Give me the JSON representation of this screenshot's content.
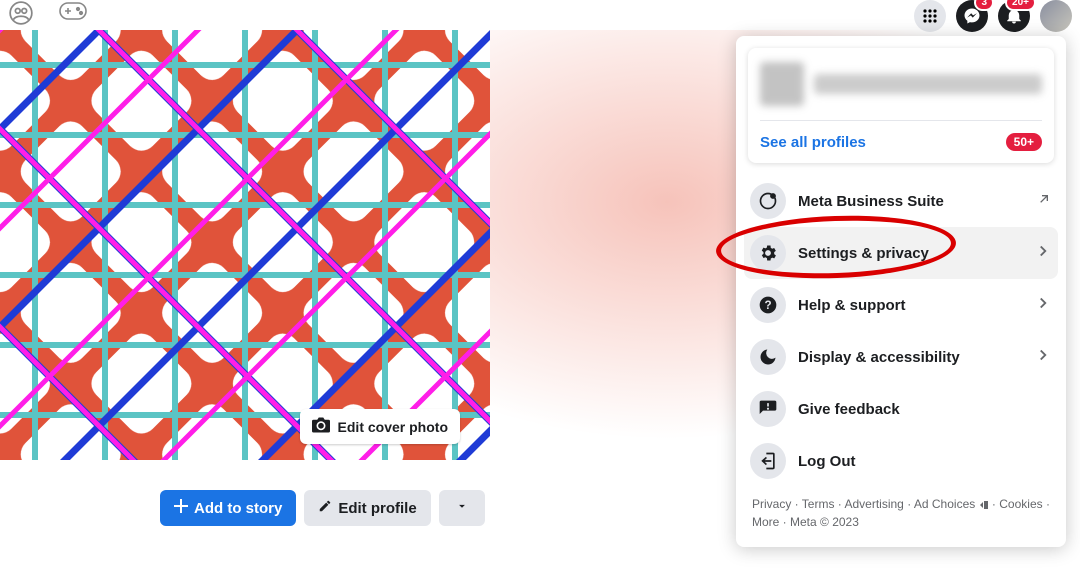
{
  "topbar": {
    "messenger_badge": "3",
    "notifications_badge": "20+"
  },
  "cover": {
    "edit_label": "Edit cover photo"
  },
  "profile_actions": {
    "add_to_story": "Add to story",
    "edit_profile": "Edit profile"
  },
  "dropdown": {
    "see_all": "See all profiles",
    "see_all_badge": "50+",
    "items": [
      {
        "label": "Meta Business Suite"
      },
      {
        "label": "Settings & privacy"
      },
      {
        "label": "Help & support"
      },
      {
        "label": "Display & accessibility"
      },
      {
        "label": "Give feedback"
      },
      {
        "label": "Log Out"
      }
    ],
    "footer": {
      "f0": "Privacy",
      "f1": "Terms",
      "f2": "Advertising",
      "f3": "Ad Choices",
      "f4": "Cookies",
      "f5": "More",
      "f6": "Meta © 2023"
    }
  }
}
